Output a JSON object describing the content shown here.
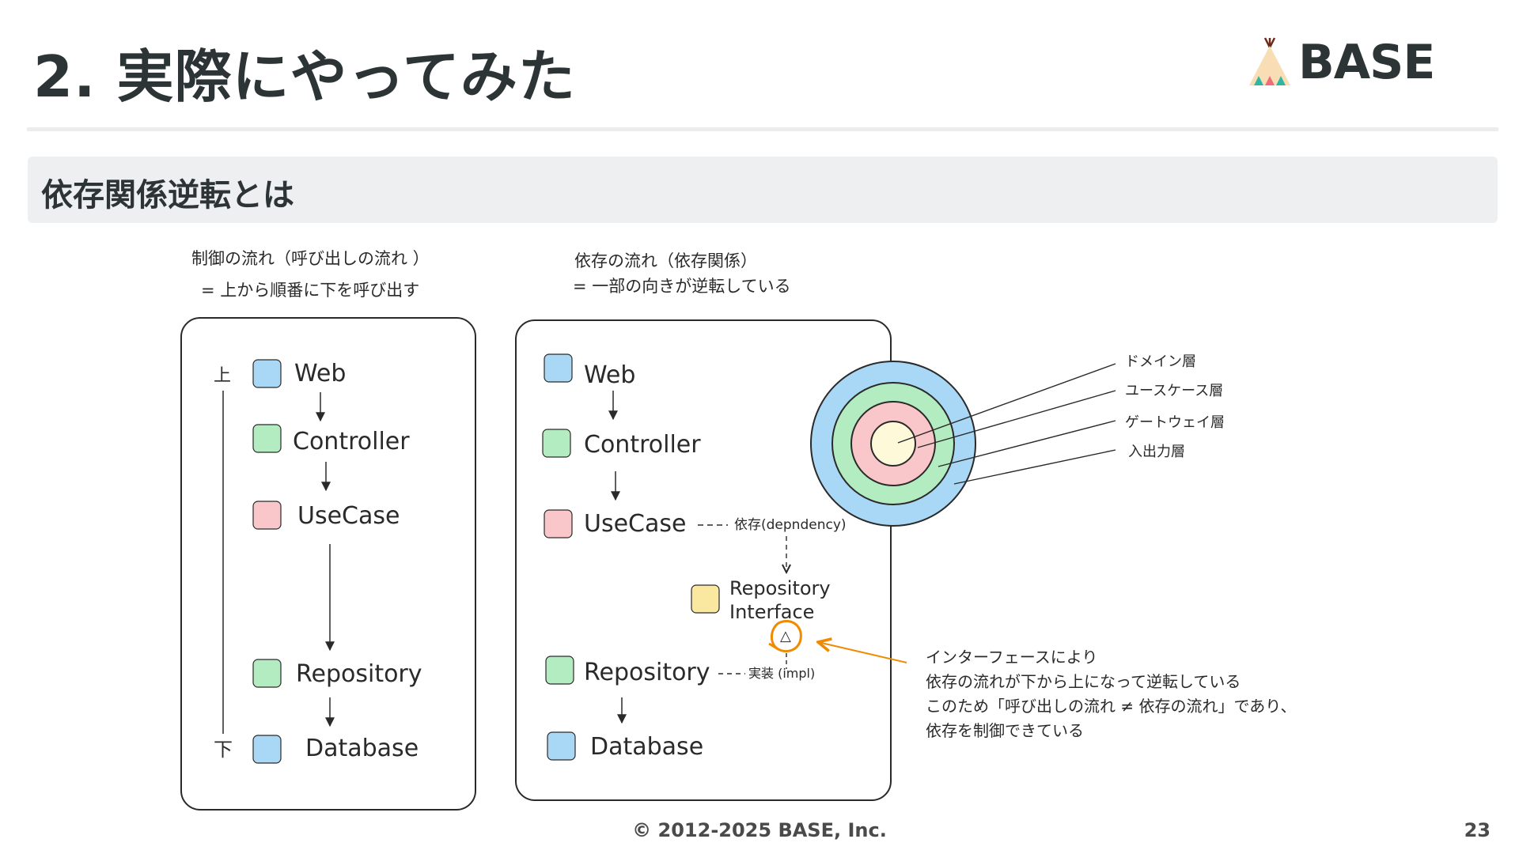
{
  "slide": {
    "title": "2. 実際にやってみた",
    "section_title": "依存関係逆転とは",
    "logo_text": "BASE",
    "footer": "© 2012-2025 BASE, Inc.",
    "page_number": "23"
  },
  "left_diagram": {
    "caption_line1": "制御の流れ（呼び出しの流れ ）",
    "caption_line2": "= 上から順番に下を呼び出す",
    "top_label": "上",
    "bottom_label": "下",
    "layers": [
      "Web",
      "Controller",
      "UseCase",
      "Repository",
      "Database"
    ]
  },
  "middle_diagram": {
    "caption_line1": "依存の流れ（依存関係）",
    "caption_line2": "= 一部の向きが逆転している",
    "layers": [
      "Web",
      "Controller",
      "UseCase",
      "Repository",
      "Database"
    ],
    "interface_line1": "Repository",
    "interface_line2": "Interface",
    "dependency_label": "依存(depndency)",
    "impl_label": "実装 (impl)",
    "triangle": "△"
  },
  "circle_diagram": {
    "labels": [
      "ドメイン層",
      "ユースケース層",
      "ゲートウェイ層",
      "入出力層"
    ]
  },
  "note": {
    "lines": [
      "インターフェースにより",
      "依存の流れが下から上になって逆転している",
      "このため「呼び出しの流れ ≠ 依存の流れ」であり、",
      "依存を制御できている"
    ]
  },
  "colors": {
    "blue": "#a8d8f5",
    "green": "#b3ecc0",
    "red": "#f9c6c9",
    "yellow": "#fbe8a0",
    "cream": "#fef9d9",
    "accent_orange": "#f08a00"
  }
}
